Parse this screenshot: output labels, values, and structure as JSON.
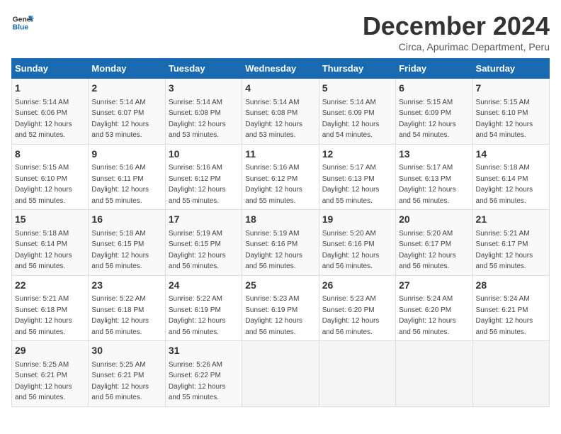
{
  "logo": {
    "line1": "General",
    "line2": "Blue"
  },
  "title": "December 2024",
  "location": "Circa, Apurimac Department, Peru",
  "days_of_week": [
    "Sunday",
    "Monday",
    "Tuesday",
    "Wednesday",
    "Thursday",
    "Friday",
    "Saturday"
  ],
  "weeks": [
    [
      {
        "day": "1",
        "sunrise": "Sunrise: 5:14 AM",
        "sunset": "Sunset: 6:06 PM",
        "daylight": "Daylight: 12 hours and 52 minutes."
      },
      {
        "day": "2",
        "sunrise": "Sunrise: 5:14 AM",
        "sunset": "Sunset: 6:07 PM",
        "daylight": "Daylight: 12 hours and 53 minutes."
      },
      {
        "day": "3",
        "sunrise": "Sunrise: 5:14 AM",
        "sunset": "Sunset: 6:08 PM",
        "daylight": "Daylight: 12 hours and 53 minutes."
      },
      {
        "day": "4",
        "sunrise": "Sunrise: 5:14 AM",
        "sunset": "Sunset: 6:08 PM",
        "daylight": "Daylight: 12 hours and 53 minutes."
      },
      {
        "day": "5",
        "sunrise": "Sunrise: 5:14 AM",
        "sunset": "Sunset: 6:09 PM",
        "daylight": "Daylight: 12 hours and 54 minutes."
      },
      {
        "day": "6",
        "sunrise": "Sunrise: 5:15 AM",
        "sunset": "Sunset: 6:09 PM",
        "daylight": "Daylight: 12 hours and 54 minutes."
      },
      {
        "day": "7",
        "sunrise": "Sunrise: 5:15 AM",
        "sunset": "Sunset: 6:10 PM",
        "daylight": "Daylight: 12 hours and 54 minutes."
      }
    ],
    [
      {
        "day": "8",
        "sunrise": "Sunrise: 5:15 AM",
        "sunset": "Sunset: 6:10 PM",
        "daylight": "Daylight: 12 hours and 55 minutes."
      },
      {
        "day": "9",
        "sunrise": "Sunrise: 5:16 AM",
        "sunset": "Sunset: 6:11 PM",
        "daylight": "Daylight: 12 hours and 55 minutes."
      },
      {
        "day": "10",
        "sunrise": "Sunrise: 5:16 AM",
        "sunset": "Sunset: 6:12 PM",
        "daylight": "Daylight: 12 hours and 55 minutes."
      },
      {
        "day": "11",
        "sunrise": "Sunrise: 5:16 AM",
        "sunset": "Sunset: 6:12 PM",
        "daylight": "Daylight: 12 hours and 55 minutes."
      },
      {
        "day": "12",
        "sunrise": "Sunrise: 5:17 AM",
        "sunset": "Sunset: 6:13 PM",
        "daylight": "Daylight: 12 hours and 55 minutes."
      },
      {
        "day": "13",
        "sunrise": "Sunrise: 5:17 AM",
        "sunset": "Sunset: 6:13 PM",
        "daylight": "Daylight: 12 hours and 56 minutes."
      },
      {
        "day": "14",
        "sunrise": "Sunrise: 5:18 AM",
        "sunset": "Sunset: 6:14 PM",
        "daylight": "Daylight: 12 hours and 56 minutes."
      }
    ],
    [
      {
        "day": "15",
        "sunrise": "Sunrise: 5:18 AM",
        "sunset": "Sunset: 6:14 PM",
        "daylight": "Daylight: 12 hours and 56 minutes."
      },
      {
        "day": "16",
        "sunrise": "Sunrise: 5:18 AM",
        "sunset": "Sunset: 6:15 PM",
        "daylight": "Daylight: 12 hours and 56 minutes."
      },
      {
        "day": "17",
        "sunrise": "Sunrise: 5:19 AM",
        "sunset": "Sunset: 6:15 PM",
        "daylight": "Daylight: 12 hours and 56 minutes."
      },
      {
        "day": "18",
        "sunrise": "Sunrise: 5:19 AM",
        "sunset": "Sunset: 6:16 PM",
        "daylight": "Daylight: 12 hours and 56 minutes."
      },
      {
        "day": "19",
        "sunrise": "Sunrise: 5:20 AM",
        "sunset": "Sunset: 6:16 PM",
        "daylight": "Daylight: 12 hours and 56 minutes."
      },
      {
        "day": "20",
        "sunrise": "Sunrise: 5:20 AM",
        "sunset": "Sunset: 6:17 PM",
        "daylight": "Daylight: 12 hours and 56 minutes."
      },
      {
        "day": "21",
        "sunrise": "Sunrise: 5:21 AM",
        "sunset": "Sunset: 6:17 PM",
        "daylight": "Daylight: 12 hours and 56 minutes."
      }
    ],
    [
      {
        "day": "22",
        "sunrise": "Sunrise: 5:21 AM",
        "sunset": "Sunset: 6:18 PM",
        "daylight": "Daylight: 12 hours and 56 minutes."
      },
      {
        "day": "23",
        "sunrise": "Sunrise: 5:22 AM",
        "sunset": "Sunset: 6:18 PM",
        "daylight": "Daylight: 12 hours and 56 minutes."
      },
      {
        "day": "24",
        "sunrise": "Sunrise: 5:22 AM",
        "sunset": "Sunset: 6:19 PM",
        "daylight": "Daylight: 12 hours and 56 minutes."
      },
      {
        "day": "25",
        "sunrise": "Sunrise: 5:23 AM",
        "sunset": "Sunset: 6:19 PM",
        "daylight": "Daylight: 12 hours and 56 minutes."
      },
      {
        "day": "26",
        "sunrise": "Sunrise: 5:23 AM",
        "sunset": "Sunset: 6:20 PM",
        "daylight": "Daylight: 12 hours and 56 minutes."
      },
      {
        "day": "27",
        "sunrise": "Sunrise: 5:24 AM",
        "sunset": "Sunset: 6:20 PM",
        "daylight": "Daylight: 12 hours and 56 minutes."
      },
      {
        "day": "28",
        "sunrise": "Sunrise: 5:24 AM",
        "sunset": "Sunset: 6:21 PM",
        "daylight": "Daylight: 12 hours and 56 minutes."
      }
    ],
    [
      {
        "day": "29",
        "sunrise": "Sunrise: 5:25 AM",
        "sunset": "Sunset: 6:21 PM",
        "daylight": "Daylight: 12 hours and 56 minutes."
      },
      {
        "day": "30",
        "sunrise": "Sunrise: 5:25 AM",
        "sunset": "Sunset: 6:21 PM",
        "daylight": "Daylight: 12 hours and 56 minutes."
      },
      {
        "day": "31",
        "sunrise": "Sunrise: 5:26 AM",
        "sunset": "Sunset: 6:22 PM",
        "daylight": "Daylight: 12 hours and 55 minutes."
      },
      null,
      null,
      null,
      null
    ]
  ]
}
